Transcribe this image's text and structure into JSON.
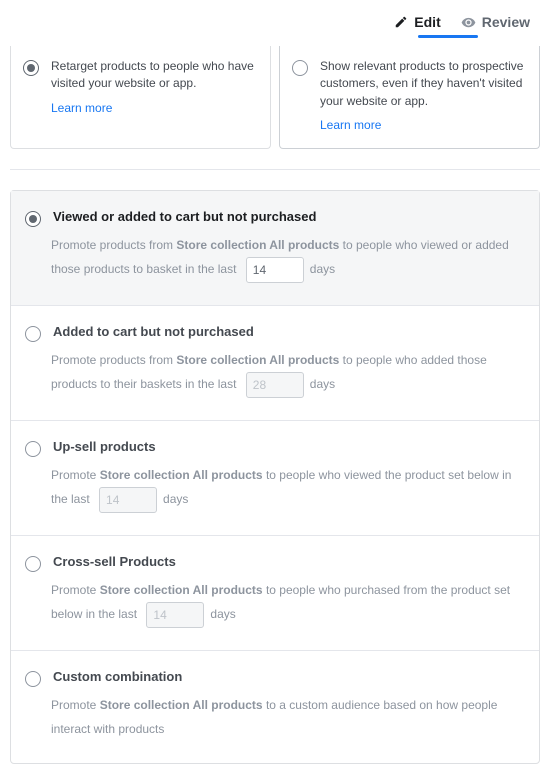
{
  "tabs": {
    "edit": "Edit",
    "review": "Review",
    "active": "edit"
  },
  "cards": {
    "retarget": {
      "text": "Retarget products to people who have visited your website or app.",
      "learn": "Learn more",
      "selected": true
    },
    "prospect": {
      "text": "Show relevant products to prospective customers, even if they haven't visited your website or app.",
      "learn": "Learn more",
      "selected": false
    }
  },
  "common": {
    "catalog": "Store collection All products",
    "days": "days"
  },
  "options": {
    "viewed": {
      "title": "Viewed or added to cart but not purchased",
      "desc_pre": "Promote products from ",
      "desc_mid": " to people who viewed or added those products to basket in the last ",
      "value": "14",
      "selected": true
    },
    "added": {
      "title": "Added to cart but not purchased",
      "desc_pre": "Promote products from ",
      "desc_mid": " to people who added those products to their baskets in the last ",
      "value": "28",
      "selected": false
    },
    "upsell": {
      "title": "Up-sell products",
      "desc_pre": "Promote ",
      "desc_mid": " to people who viewed the product set below in the last ",
      "value": "14",
      "selected": false
    },
    "cross": {
      "title": "Cross-sell Products",
      "desc_pre": "Promote ",
      "desc_mid": " to people who purchased from the product set below in the last ",
      "value": "14",
      "selected": false
    },
    "custom": {
      "title": "Custom combination",
      "desc_pre": "Promote ",
      "desc_mid": " to a custom audience based on how people interact with products",
      "selected": false
    }
  }
}
